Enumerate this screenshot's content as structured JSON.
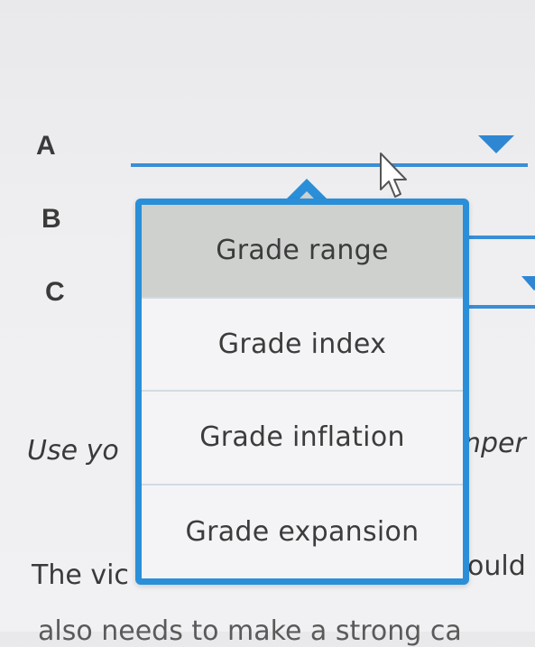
{
  "rows": {
    "a_label": "A",
    "b_label": "B",
    "c_label": "C"
  },
  "dropdown": {
    "options": [
      {
        "label": "Grade range",
        "selected": true
      },
      {
        "label": "Grade index",
        "selected": false
      },
      {
        "label": "Grade inflation",
        "selected": false
      },
      {
        "label": "Grade expansion",
        "selected": false
      }
    ]
  },
  "background_text": {
    "line1_left": "Use yo",
    "line1_right": "nper",
    "line2_left": "The vic",
    "line2_right": "ould",
    "line3": "also needs to make a strong ca"
  },
  "colors": {
    "accent": "#2a8fd8",
    "selected_option": "#cfd1cf",
    "text": "#3a3a3a"
  }
}
